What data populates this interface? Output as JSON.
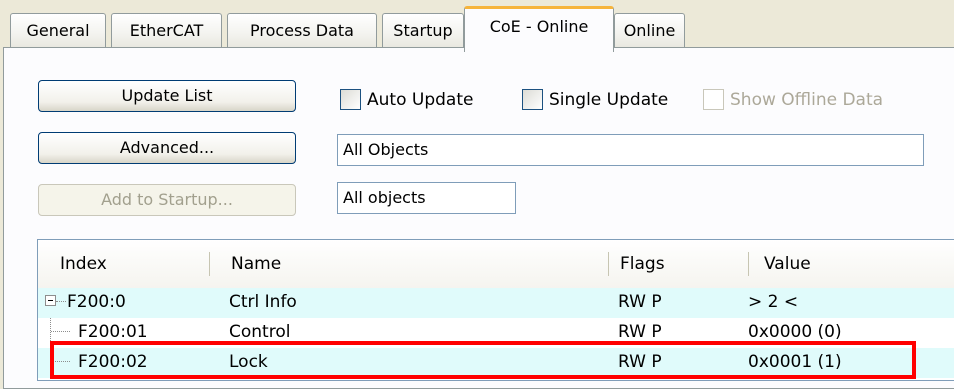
{
  "tabs": [
    {
      "label": "General"
    },
    {
      "label": "EtherCAT"
    },
    {
      "label": "Process Data"
    },
    {
      "label": "Startup"
    },
    {
      "label": "CoE - Online"
    },
    {
      "label": "Online"
    }
  ],
  "active_tab": "CoE - Online",
  "buttons": {
    "update_list": "Update List",
    "advanced": "Advanced...",
    "add_to_startup": "Add to Startup..."
  },
  "checkboxes": {
    "auto_update": {
      "label": "Auto Update",
      "checked": false
    },
    "single_update": {
      "label": "Single Update",
      "checked": false
    },
    "show_offline": {
      "label": "Show Offline Data",
      "checked": false,
      "disabled": true
    }
  },
  "fields": {
    "filter_objects": "All Objects",
    "object_scope": "All objects"
  },
  "table": {
    "columns": {
      "index": "Index",
      "name": "Name",
      "flags": "Flags",
      "value": "Value"
    },
    "rows": [
      {
        "index": "F200:0",
        "name": "Ctrl Info",
        "flags": "RW P",
        "value": "> 2 <"
      },
      {
        "index": "F200:01",
        "name": "Control",
        "flags": "RW P",
        "value": "0x0000 (0)"
      },
      {
        "index": "F200:02",
        "name": "Lock",
        "flags": "RW P",
        "value": "0x0001 (1)"
      }
    ]
  },
  "highlight_color": "#ff0000"
}
